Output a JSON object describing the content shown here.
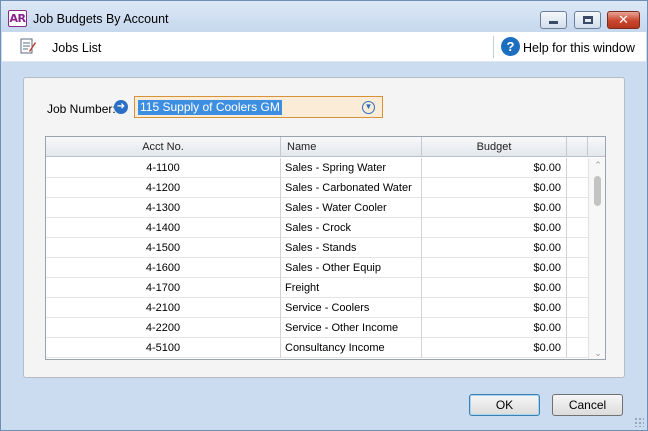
{
  "window": {
    "app_badge": "AR",
    "title": "Job Budgets By Account",
    "close_glyph": "✕"
  },
  "toolbar": {
    "jobs_list_label": "Jobs List",
    "help_label": "Help for this window",
    "help_glyph": "?"
  },
  "job": {
    "label": "Job Number:",
    "value": "115 Supply of Coolers GM"
  },
  "table": {
    "columns": [
      "Acct No.",
      "Name",
      "Budget"
    ],
    "rows": [
      {
        "acct": "4-1100",
        "name": "Sales - Spring Water",
        "budget": "$0.00"
      },
      {
        "acct": "4-1200",
        "name": "Sales - Carbonated Water",
        "budget": "$0.00"
      },
      {
        "acct": "4-1300",
        "name": "Sales - Water Cooler",
        "budget": "$0.00"
      },
      {
        "acct": "4-1400",
        "name": "Sales - Crock",
        "budget": "$0.00"
      },
      {
        "acct": "4-1500",
        "name": "Sales - Stands",
        "budget": "$0.00"
      },
      {
        "acct": "4-1600",
        "name": "Sales - Other Equip",
        "budget": "$0.00"
      },
      {
        "acct": "4-1700",
        "name": "Freight",
        "budget": "$0.00"
      },
      {
        "acct": "4-2100",
        "name": "Service - Coolers",
        "budget": "$0.00"
      },
      {
        "acct": "4-2200",
        "name": "Service - Other Income",
        "budget": "$0.00"
      },
      {
        "acct": "4-5100",
        "name": "Consultancy Income",
        "budget": "$0.00"
      }
    ]
  },
  "buttons": {
    "ok": "OK",
    "cancel": "Cancel"
  },
  "colors": {
    "title_bar": "#c6d8ee",
    "combo_background": "#fbecd8",
    "combo_border": "#d8923a",
    "selection": "#3d8ee0",
    "help_icon": "#1c6fbf"
  }
}
